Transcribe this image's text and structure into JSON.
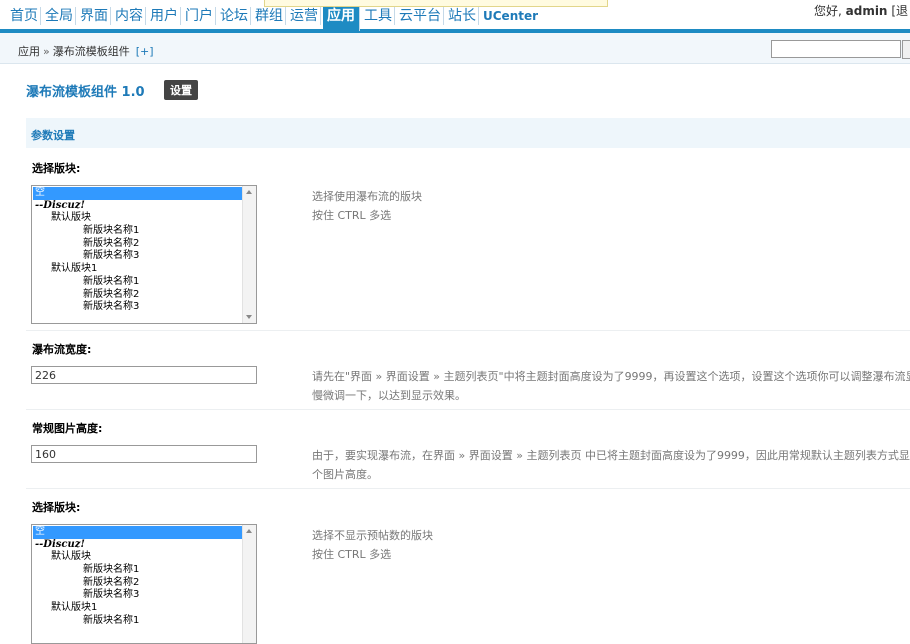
{
  "topnav": {
    "items": [
      "首页",
      "全局",
      "界面",
      "内容",
      "用户",
      "门户",
      "论坛",
      "群组",
      "运营",
      "应用",
      "工具",
      "云平台",
      "站长",
      "UCenter"
    ],
    "active_index": 9,
    "user_greeting": "您好,",
    "username": "admin",
    "user_suffix": "[退"
  },
  "breadcrumb": {
    "root": "应用",
    "sep": "»",
    "current": "瀑布流模板组件",
    "add": "[+]"
  },
  "search": {
    "value": ""
  },
  "header": {
    "title": "瀑布流模板组件 1.0",
    "settings_button": "设置"
  },
  "section": {
    "title": "参数设置"
  },
  "settings": [
    {
      "label": "选择版块:",
      "type": "multiselect",
      "options": [
        {
          "text": "空",
          "indent": 0,
          "selected": true,
          "root": false
        },
        {
          "text": "--Discuz!",
          "indent": 0,
          "selected": false,
          "root": true
        },
        {
          "text": "默认版块",
          "indent": 1,
          "selected": false,
          "root": false
        },
        {
          "text": "新版块名称1",
          "indent": 2,
          "selected": false,
          "root": false
        },
        {
          "text": "新版块名称2",
          "indent": 2,
          "selected": false,
          "root": false
        },
        {
          "text": "新版块名称3",
          "indent": 2,
          "selected": false,
          "root": false
        },
        {
          "text": "默认版块1",
          "indent": 1,
          "selected": false,
          "root": false
        },
        {
          "text": "新版块名称1",
          "indent": 2,
          "selected": false,
          "root": false
        },
        {
          "text": "新版块名称2",
          "indent": 2,
          "selected": false,
          "root": false
        },
        {
          "text": "新版块名称3",
          "indent": 2,
          "selected": false,
          "root": false
        }
      ],
      "desc": [
        "选择使用瀑布流的版块",
        "按住 CTRL 多选"
      ]
    },
    {
      "label": "瀑布流宽度:",
      "type": "text",
      "value": "226",
      "desc": [
        "请先在\"界面 » 界面设置 » 主题列表页\"中将主题封面高度设为了9999，再设置这个选项，设置这个选项你可以调整瀑布流显示",
        "慢微调一下，以达到显示效果。"
      ]
    },
    {
      "label": "常规图片高度:",
      "type": "text",
      "value": "160",
      "desc": [
        "由于，要实现瀑布流，在界面 » 界面设置 » 主题列表页 中已将主题封面高度设为了9999，因此用常规默认主题列表方式显示",
        "个图片高度。"
      ]
    },
    {
      "label": "选择版块:",
      "type": "multiselect",
      "options": [
        {
          "text": "空",
          "indent": 0,
          "selected": true,
          "root": false
        },
        {
          "text": "--Discuz!",
          "indent": 0,
          "selected": false,
          "root": true
        },
        {
          "text": "默认版块",
          "indent": 1,
          "selected": false,
          "root": false
        },
        {
          "text": "新版块名称1",
          "indent": 2,
          "selected": false,
          "root": false
        },
        {
          "text": "新版块名称2",
          "indent": 2,
          "selected": false,
          "root": false
        },
        {
          "text": "新版块名称3",
          "indent": 2,
          "selected": false,
          "root": false
        },
        {
          "text": "默认版块1",
          "indent": 1,
          "selected": false,
          "root": false
        },
        {
          "text": "新版块名称1",
          "indent": 2,
          "selected": false,
          "root": false
        }
      ],
      "desc": [
        "选择不显示预帖数的版块",
        "按住 CTRL 多选"
      ]
    }
  ]
}
